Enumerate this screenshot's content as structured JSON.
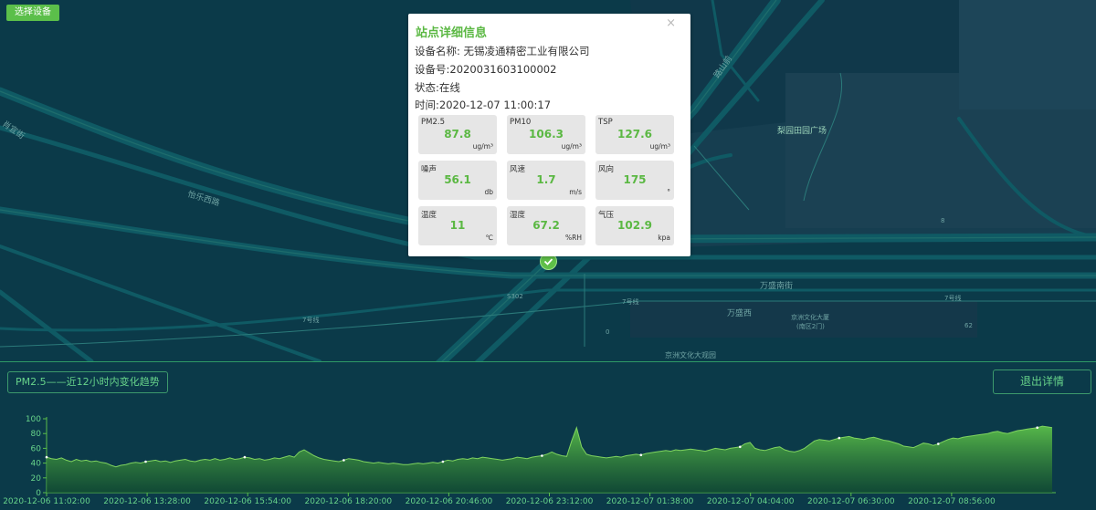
{
  "toolbar": {
    "select_device_label": "选择设备"
  },
  "map": {
    "labels": {
      "xiaoshan_street": "肖宜街",
      "yile_west_road": "怡乐西路",
      "mountain_road": "路山前",
      "plaza": "梨园田园广场",
      "wansheng_south": "万盛南街",
      "wansheng_west": "万盛西",
      "line7_a": "7号线",
      "line7_b": "7号线",
      "line7_c": "7号线",
      "culture_tower": "京洲文化大厦",
      "culture_tower_sub": "(南区2门)",
      "culture_park": "京洲文化大观园",
      "num_8": "8",
      "num_0": "0",
      "num_62": "62",
      "s302": "S302"
    }
  },
  "popup": {
    "title": "站点详细信息",
    "close": "×",
    "device_name": "设备名称: 无锡凌通精密工业有限公司",
    "device_id": "设备号:2020031603100002",
    "status": "状态:在线",
    "time": "时间:2020-12-07 11:00:17",
    "cards": [
      {
        "name": "PM2.5",
        "value": "87.8",
        "unit": "ug/m³"
      },
      {
        "name": "PM10",
        "value": "106.3",
        "unit": "ug/m³"
      },
      {
        "name": "TSP",
        "value": "127.6",
        "unit": "ug/m³"
      },
      {
        "name": "噪声",
        "value": "56.1",
        "unit": "db"
      },
      {
        "name": "风速",
        "value": "1.7",
        "unit": "m/s"
      },
      {
        "name": "风向",
        "value": "175",
        "unit": "°"
      },
      {
        "name": "温度",
        "value": "11",
        "unit": "℃"
      },
      {
        "name": "湿度",
        "value": "67.2",
        "unit": "%RH"
      },
      {
        "name": "气压",
        "value": "102.9",
        "unit": "kpa"
      }
    ]
  },
  "trend": {
    "label": "PM2.5——近12小时内变化趋势",
    "exit_label": "退出详情"
  },
  "chart_data": {
    "type": "area",
    "title": "",
    "xlabel": "",
    "ylabel": "",
    "ylim": [
      0,
      100
    ],
    "yticks": [
      0,
      20,
      40,
      60,
      80,
      100
    ],
    "grid": false,
    "color": "#5bbf4a",
    "x_tick_labels": [
      "2020-12-06 11:02:00",
      "2020-12-06 13:28:00",
      "2020-12-06 15:54:00",
      "2020-12-06 18:20:00",
      "2020-12-06 20:46:00",
      "2020-12-06 23:12:00",
      "2020-12-07 01:38:00",
      "2020-12-07 04:04:00",
      "2020-12-07 06:30:00",
      "2020-12-07 08:56:00"
    ],
    "x_start": "2020-12-06 11:02:00",
    "x_end": "2020-12-07 11:00:00",
    "values": [
      48,
      46,
      45,
      47,
      44,
      42,
      45,
      43,
      44,
      42,
      43,
      41,
      40,
      37,
      35,
      37,
      38,
      40,
      41,
      40,
      42,
      43,
      44,
      42,
      43,
      41,
      43,
      44,
      45,
      43,
      42,
      44,
      45,
      44,
      46,
      44,
      45,
      47,
      45,
      46,
      48,
      47,
      45,
      46,
      44,
      45,
      47,
      46,
      48,
      50,
      48,
      55,
      58,
      54,
      50,
      47,
      45,
      44,
      43,
      42,
      44,
      46,
      45,
      44,
      42,
      41,
      40,
      41,
      40,
      39,
      40,
      39,
      38,
      38,
      39,
      40,
      39,
      40,
      41,
      40,
      42,
      44,
      43,
      45,
      46,
      45,
      47,
      46,
      48,
      47,
      46,
      45,
      44,
      45,
      46,
      48,
      47,
      46,
      48,
      49,
      50,
      52,
      55,
      52,
      50,
      49,
      70,
      88,
      62,
      52,
      50,
      49,
      48,
      47,
      48,
      49,
      48,
      50,
      51,
      52,
      51,
      53,
      54,
      55,
      56,
      57,
      56,
      58,
      57,
      58,
      59,
      58,
      57,
      56,
      58,
      60,
      59,
      58,
      60,
      61,
      62,
      66,
      68,
      60,
      58,
      57,
      59,
      61,
      62,
      58,
      56,
      55,
      57,
      60,
      65,
      70,
      72,
      71,
      70,
      72,
      74,
      75,
      76,
      74,
      73,
      72,
      74,
      75,
      73,
      71,
      70,
      68,
      66,
      63,
      62,
      61,
      64,
      67,
      66,
      64,
      66,
      69,
      72,
      74,
      73,
      75,
      76,
      77,
      78,
      79,
      80,
      82,
      83,
      81,
      80,
      82,
      84,
      85,
      86,
      87,
      88,
      90,
      89,
      88
    ]
  }
}
